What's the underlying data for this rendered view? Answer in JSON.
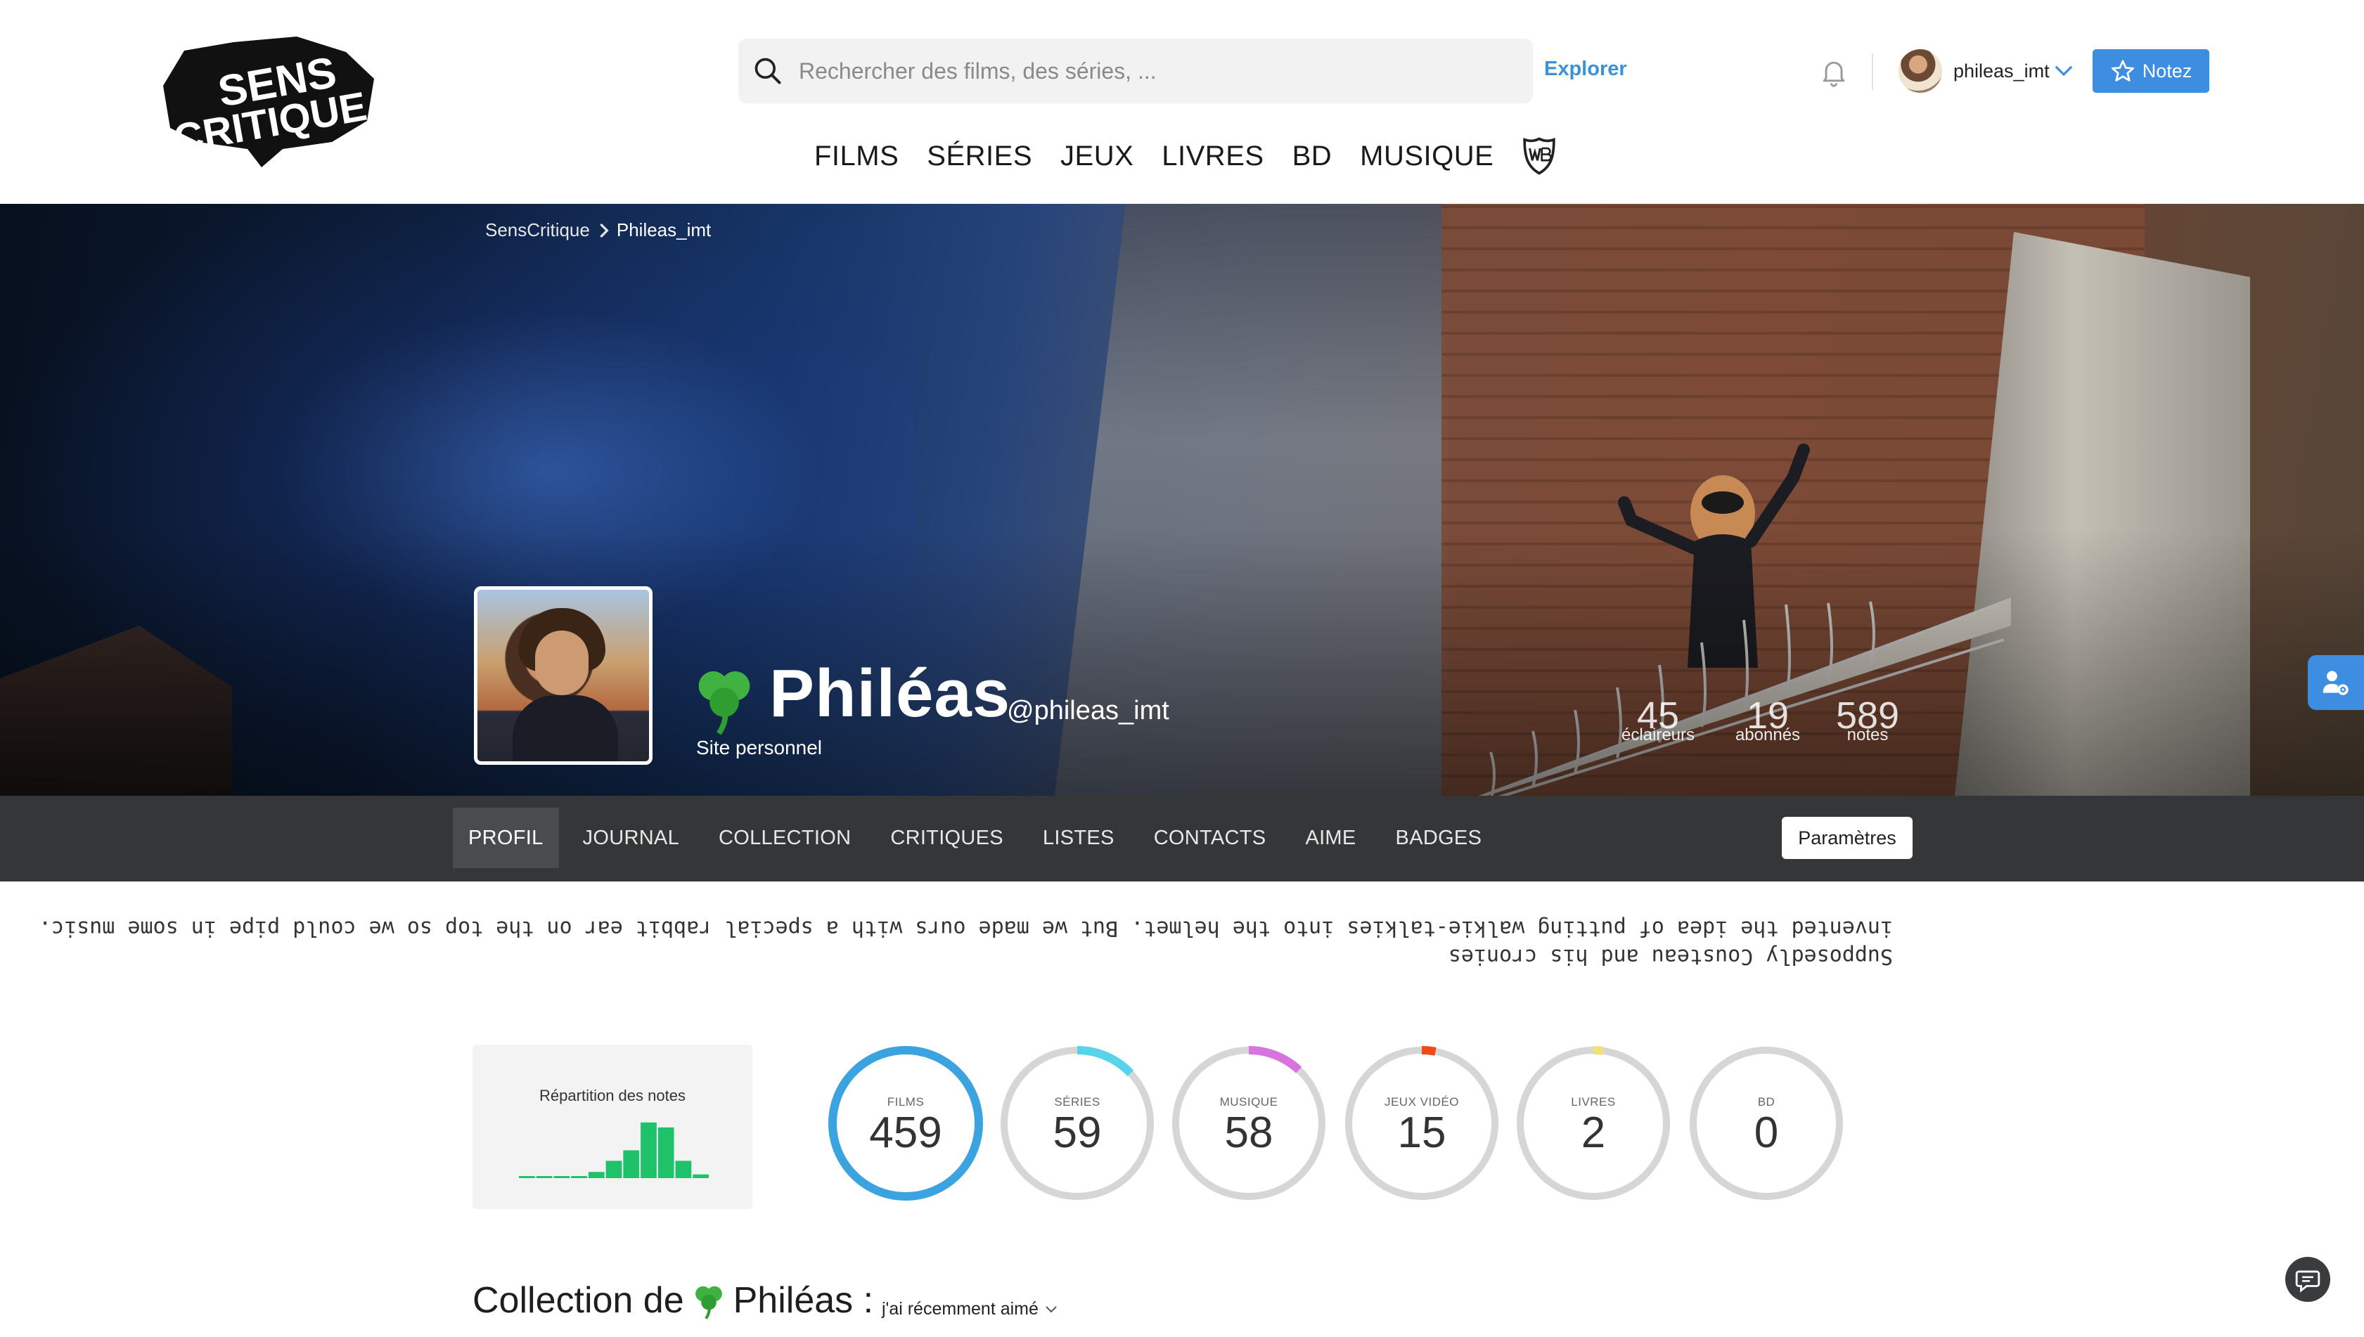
{
  "brand": {
    "logo_text_line1": "SENS",
    "logo_text_line2": "CRITIQUE"
  },
  "header": {
    "search_placeholder": "Rechercher des films, des séries, ...",
    "explore_label": "Explorer",
    "username": "phileas_imt",
    "notez_label": "Notez",
    "nav": [
      "FILMS",
      "SÉRIES",
      "JEUX",
      "LIVRES",
      "BD",
      "MUSIQUE"
    ],
    "icons": {
      "search": "search-icon",
      "bell": "bell-icon",
      "chevron": "chevron-down-icon",
      "star": "star-icon",
      "partner": "wb-shield-icon"
    }
  },
  "breadcrumb": {
    "root": "SensCritique",
    "current": "Phileas_imt"
  },
  "profile": {
    "display_name": "Philéas",
    "emoji_icon": "clover-icon",
    "handle": "@phileas_imt",
    "website_label": "Site personnel",
    "stats": [
      {
        "value": "45",
        "label": "éclaireurs"
      },
      {
        "value": "19",
        "label": "abonnés"
      },
      {
        "value": "589",
        "label": "notes"
      }
    ]
  },
  "tabs": {
    "items": [
      "PROFIL",
      "JOURNAL",
      "COLLECTION",
      "CRITIQUES",
      "LISTES",
      "CONTACTS",
      "AIME",
      "BADGES"
    ],
    "active_index": 0,
    "settings_label": "Paramètres"
  },
  "bio": {
    "line1": "Supposedly Cousteau and his cronies",
    "line2": "invented the idea of putting walkie-talkies into the helmet. But we made ours with a special rabbit ear on the top so we could pipe in some music."
  },
  "ratings": {
    "title": "Répartition des notes",
    "distribution": [
      0.03,
      0.03,
      0.03,
      0.03,
      0.1,
      0.28,
      0.45,
      0.9,
      0.82,
      0.28,
      0.06
    ],
    "bar_color": "#1fc16b"
  },
  "counters": [
    {
      "label": "FILMS",
      "value": "459",
      "color": "#3aa3e0",
      "fraction": 1.0
    },
    {
      "label": "SÉRIES",
      "value": "59",
      "color": "#57d3ea",
      "fraction": 0.13
    },
    {
      "label": "MUSIQUE",
      "value": "58",
      "color": "#d874de",
      "fraction": 0.12
    },
    {
      "label": "JEUX VIDÉO",
      "value": "15",
      "color": "#f04b17",
      "fraction": 0.03
    },
    {
      "label": "LIVRES",
      "value": "2",
      "color": "#f2e07c",
      "fraction": 0.01
    },
    {
      "label": "BD",
      "value": "0",
      "color": "#d9d9d9",
      "fraction": 0.0
    }
  ],
  "collection": {
    "title_prefix": "Collection de",
    "name": "Philéas :",
    "filter_label": "j'ai récemment aimé"
  }
}
